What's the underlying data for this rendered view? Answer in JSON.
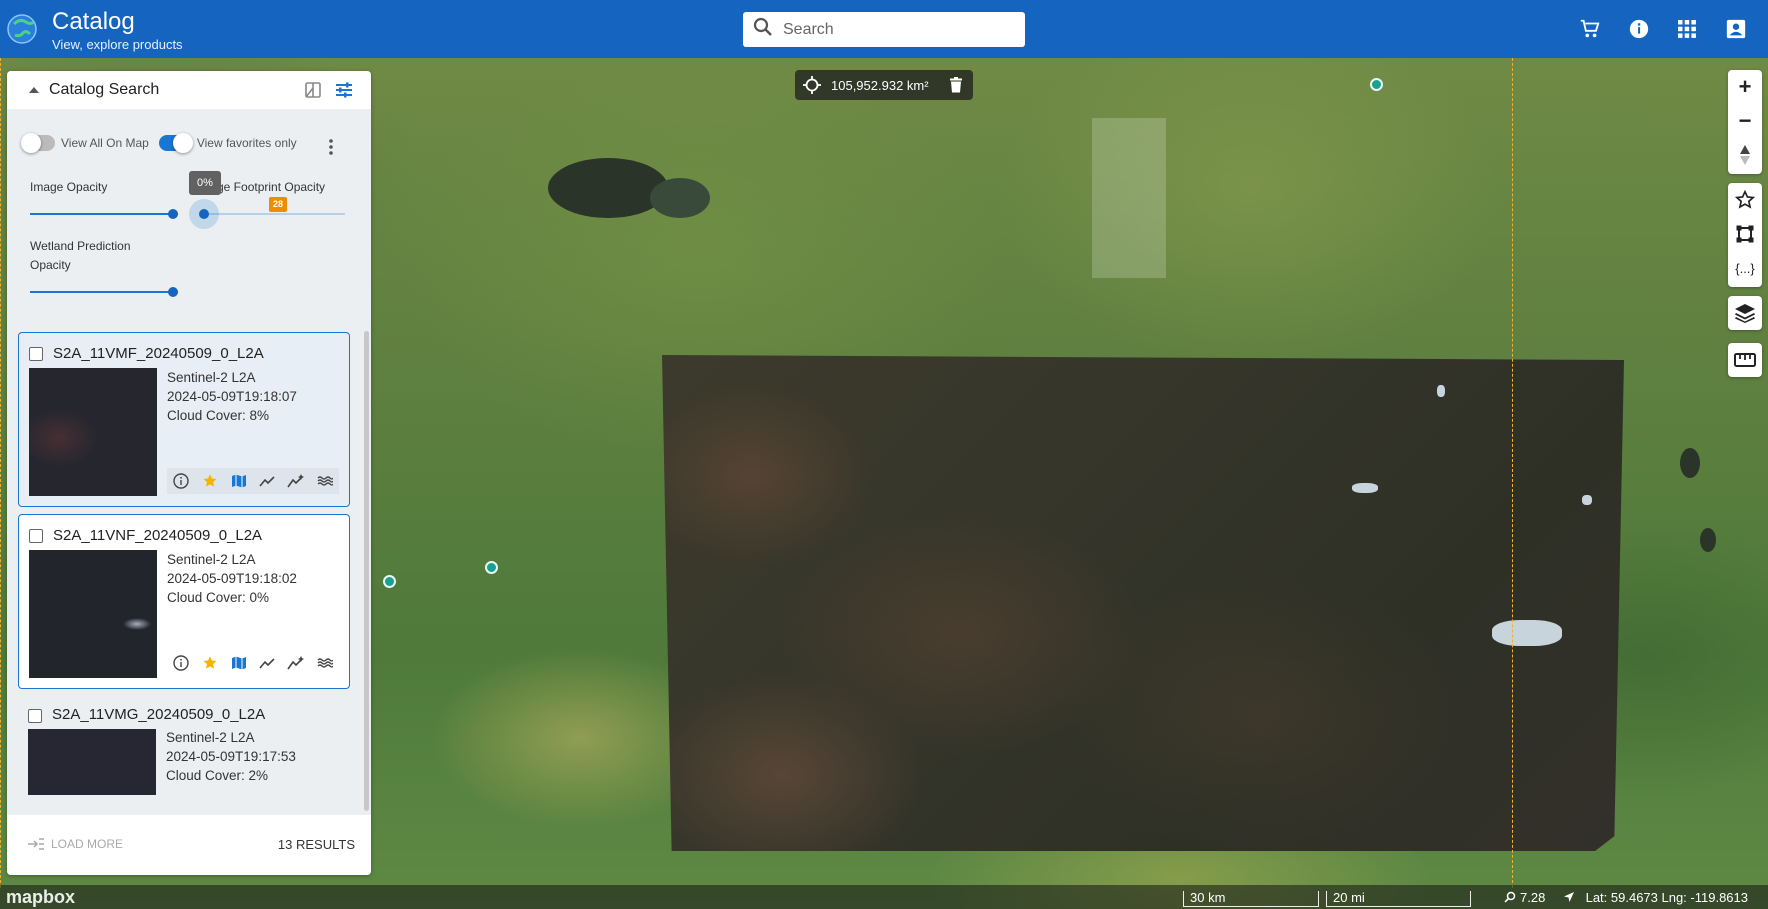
{
  "header": {
    "title": "Catalog",
    "subtitle": "View, explore products",
    "search_placeholder": "Search"
  },
  "icons": {
    "logo": "globe-icon",
    "cart": "cart-icon",
    "info": "info-icon",
    "apps": "apps-grid-icon",
    "account": "account-icon"
  },
  "map": {
    "area_readout": "105,952.932 km²",
    "scale_km": "30 km",
    "scale_mi": "20 mi",
    "zoom": "7.28",
    "coords": "Lat: 59.4673 Lng: -119.8613",
    "attribution": "mapbox"
  },
  "tools": {
    "zoom_in": "+",
    "zoom_out": "−",
    "braces": "{...}"
  },
  "panel": {
    "title": "Catalog Search",
    "toggle_view_all": "View All On Map",
    "toggle_view_all_on": false,
    "toggle_favorites": "View favorites only",
    "toggle_favorites_on": true,
    "image_opacity_label": "Image Opacity",
    "footprint_opacity_label": "Image Footprint Opacity",
    "footprint_tooltip": "0%",
    "footprint_badge": "28",
    "wetland_label_line1": "Wetland Prediction",
    "wetland_label_line2": "Opacity",
    "load_more": "LOAD MORE",
    "results": "13 RESULTS",
    "image_opacity_value": 1.0,
    "footprint_opacity_value": 0.0,
    "wetland_opacity_value": 1.0
  },
  "results": [
    {
      "name": "S2A_11VMF_20240509_0_L2A",
      "product": "Sentinel-2 L2A",
      "datetime": "2024-05-09T19:18:07",
      "cloud": "Cloud Cover: 8%",
      "favorite": true
    },
    {
      "name": "S2A_11VNF_20240509_0_L2A",
      "product": "Sentinel-2 L2A",
      "datetime": "2024-05-09T19:18:02",
      "cloud": "Cloud Cover: 0%",
      "favorite": true
    },
    {
      "name": "S2A_11VMG_20240509_0_L2A",
      "product": "Sentinel-2 L2A",
      "datetime": "2024-05-09T19:17:53",
      "cloud": "Cloud Cover: 2%",
      "favorite": false
    }
  ],
  "colors": {
    "header_blue": "#1565c0",
    "accent_blue": "#1976d2",
    "favorite_star": "#f4b400",
    "footprint_orange": "#f0b030",
    "marker_teal": "#1aa090"
  }
}
